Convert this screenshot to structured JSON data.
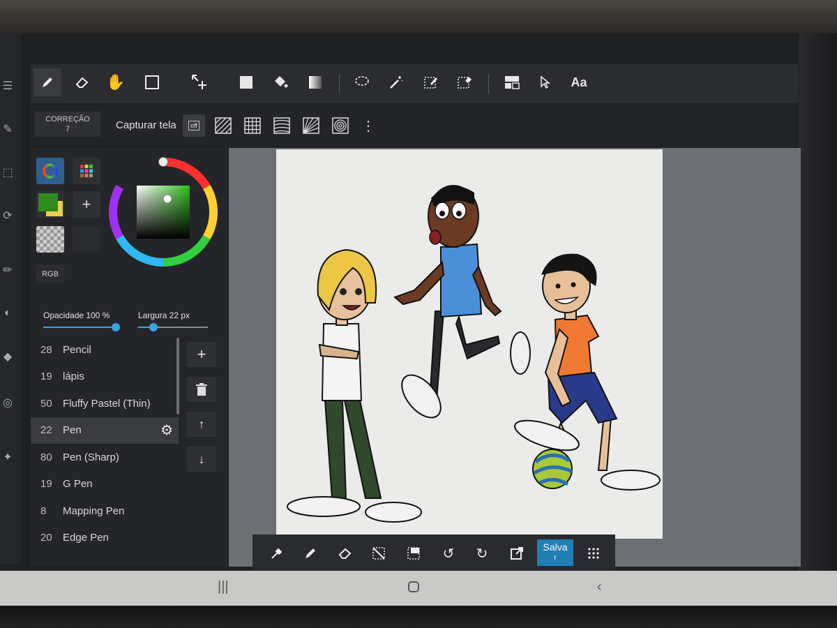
{
  "toolbar": {
    "tools": [
      "pen-icon",
      "eraser-icon",
      "hand-icon",
      "rectangle-icon",
      "move-icon",
      "fill-square-icon",
      "bucket-icon",
      "gradient-icon",
      "lasso-icon",
      "magic-wand-icon",
      "select-pen-icon",
      "select-eraser-icon",
      "layer-panel-icon",
      "pointer-icon"
    ],
    "text_tool_label": "Aa"
  },
  "subbar": {
    "correction_label": "CORREÇÃO",
    "correction_value": "7",
    "snap_label": "Capturar tela",
    "snap_off_label": "off"
  },
  "color_panel": {
    "current_color": "#2f8a1e",
    "secondary_color": "#e6d24a",
    "mode_label": "RGB"
  },
  "sliders": {
    "opacity_label": "Opacidade",
    "opacity_value": "100",
    "opacity_unit": "%",
    "opacity_fraction": 1.0,
    "width_label": "Largura",
    "width_value": "22",
    "width_unit": "px",
    "width_fraction": 0.22
  },
  "brushes": [
    {
      "size": "28",
      "name": "Pencil"
    },
    {
      "size": "19",
      "name": "lápis"
    },
    {
      "size": "50",
      "name": "Fluffy Pastel (Thin)"
    },
    {
      "size": "22",
      "name": "Pen"
    },
    {
      "size": "80",
      "name": "Pen (Sharp)"
    },
    {
      "size": "19",
      "name": "G Pen"
    },
    {
      "size": "8",
      "name": "Mapping Pen"
    },
    {
      "size": "20",
      "name": "Edge Pen"
    }
  ],
  "bottom_toolbar": {
    "tools": [
      "eyedropper-icon",
      "pen-icon",
      "eraser-icon",
      "deselect-icon",
      "transform-icon",
      "undo-icon",
      "redo-icon",
      "export-icon",
      "menu-grid-icon"
    ],
    "save_label": "Salva",
    "save_label_line2": "r"
  },
  "colors": {
    "accent": "#1f7fb3",
    "slider": "#3aa3d9"
  }
}
